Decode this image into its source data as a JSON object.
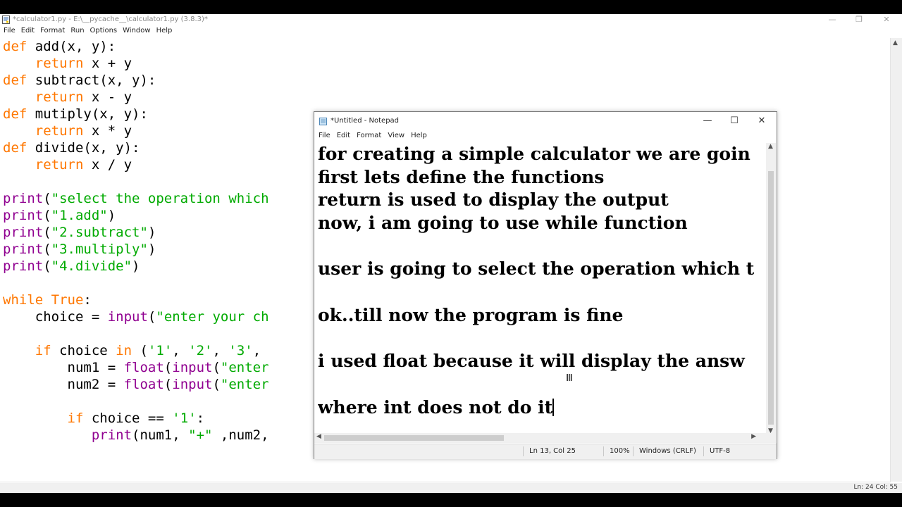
{
  "idle": {
    "title": "*calculator1.py - E:\\__pycache__\\calculator1.py (3.8.3)*",
    "menu": [
      "File",
      "Edit",
      "Format",
      "Run",
      "Options",
      "Window",
      "Help"
    ],
    "status": "Ln: 24   Col: 55",
    "code_lines": [
      [
        [
          "kw",
          "def"
        ],
        [
          "",
          " add(x, y):"
        ]
      ],
      [
        [
          "",
          "    "
        ],
        [
          "kw",
          "return"
        ],
        [
          "",
          " x + y"
        ]
      ],
      [
        [
          "kw",
          "def"
        ],
        [
          "",
          " subtract(x, y):"
        ]
      ],
      [
        [
          "",
          "    "
        ],
        [
          "kw",
          "return"
        ],
        [
          "",
          " x - y"
        ]
      ],
      [
        [
          "kw",
          "def"
        ],
        [
          "",
          " mutiply(x, y):"
        ]
      ],
      [
        [
          "",
          "    "
        ],
        [
          "kw",
          "return"
        ],
        [
          "",
          " x * y"
        ]
      ],
      [
        [
          "kw",
          "def"
        ],
        [
          "",
          " divide(x, y):"
        ]
      ],
      [
        [
          "",
          "    "
        ],
        [
          "kw",
          "return"
        ],
        [
          "",
          " x / y"
        ]
      ],
      [],
      [
        [
          "bi",
          "print"
        ],
        [
          "",
          "("
        ],
        [
          "st",
          "\"select the operation which"
        ]
      ],
      [
        [
          "bi",
          "print"
        ],
        [
          "",
          "("
        ],
        [
          "st",
          "\"1.add\""
        ],
        [
          "",
          ")"
        ]
      ],
      [
        [
          "bi",
          "print"
        ],
        [
          "",
          "("
        ],
        [
          "st",
          "\"2.subtract\""
        ],
        [
          "",
          ")"
        ]
      ],
      [
        [
          "bi",
          "print"
        ],
        [
          "",
          "("
        ],
        [
          "st",
          "\"3.multiply\""
        ],
        [
          "",
          ")"
        ]
      ],
      [
        [
          "bi",
          "print"
        ],
        [
          "",
          "("
        ],
        [
          "st",
          "\"4.divide\""
        ],
        [
          "",
          ")"
        ]
      ],
      [],
      [
        [
          "kw",
          "while"
        ],
        [
          "",
          " "
        ],
        [
          "kw",
          "True"
        ],
        [
          "",
          ":"
        ]
      ],
      [
        [
          "",
          "    choice = "
        ],
        [
          "bi",
          "input"
        ],
        [
          "",
          "("
        ],
        [
          "st",
          "\"enter your ch"
        ]
      ],
      [],
      [
        [
          "",
          "    "
        ],
        [
          "kw",
          "if"
        ],
        [
          "",
          " choice "
        ],
        [
          "kw",
          "in"
        ],
        [
          "",
          " ("
        ],
        [
          "st",
          "'1'"
        ],
        [
          "",
          ", "
        ],
        [
          "st",
          "'2'"
        ],
        [
          "",
          ", "
        ],
        [
          "st",
          "'3'"
        ],
        [
          "",
          ","
        ]
      ],
      [
        [
          "",
          "        num1 = "
        ],
        [
          "bi",
          "float"
        ],
        [
          "",
          "("
        ],
        [
          "bi",
          "input"
        ],
        [
          "",
          "("
        ],
        [
          "st",
          "\"enter"
        ]
      ],
      [
        [
          "",
          "        num2 = "
        ],
        [
          "bi",
          "float"
        ],
        [
          "",
          "("
        ],
        [
          "bi",
          "input"
        ],
        [
          "",
          "("
        ],
        [
          "st",
          "\"enter"
        ]
      ],
      [],
      [
        [
          "",
          "        "
        ],
        [
          "kw",
          "if"
        ],
        [
          "",
          " choice == "
        ],
        [
          "st",
          "'1'"
        ],
        [
          "",
          ":"
        ]
      ],
      [
        [
          "",
          "           "
        ],
        [
          "bi",
          "print"
        ],
        [
          "",
          "(num1, "
        ],
        [
          "st",
          "\"+\""
        ],
        [
          "",
          " ,num2,"
        ]
      ]
    ]
  },
  "notepad": {
    "title": "*Untitled - Notepad",
    "menu": [
      "File",
      "Edit",
      "Format",
      "View",
      "Help"
    ],
    "lines": [
      "for creating a simple calculator we are goin",
      "first lets define the functions",
      "return is used to display the output",
      "now, i am going to use while function",
      "",
      "user is going to select the operation which t",
      "",
      "ok..till now the program is fine",
      "",
      "i used float because it will display the answ",
      "",
      "where int does not do it"
    ],
    "status": {
      "position": "Ln 13, Col 25",
      "zoom": "100%",
      "line_ending": "Windows (CRLF)",
      "encoding": "UTF-8"
    }
  }
}
